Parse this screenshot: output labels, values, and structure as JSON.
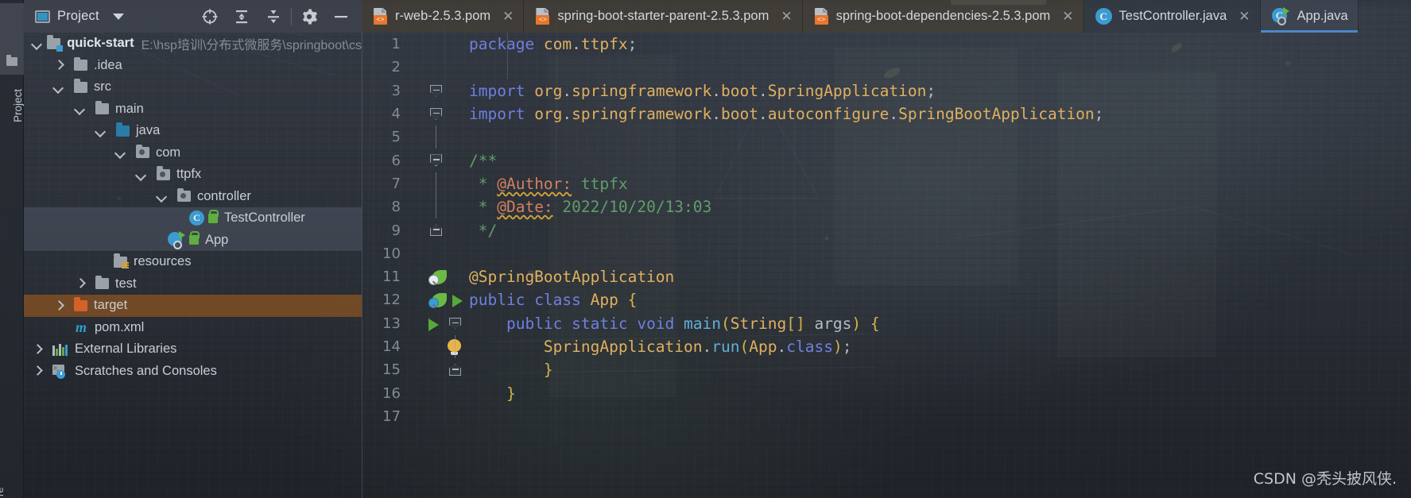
{
  "window": {
    "left_tool_bar": {
      "project_tab": "Project",
      "bottom_tab": "re"
    }
  },
  "project_panel": {
    "title": "Project",
    "icons": [
      {
        "name": "locate-icon",
        "glyph": "target"
      },
      {
        "name": "expand-all-icon",
        "glyph": "expand"
      },
      {
        "name": "collapse-all-icon",
        "glyph": "collapse"
      },
      {
        "name": "settings-gear-icon",
        "glyph": "gear"
      },
      {
        "name": "hide-icon",
        "glyph": "minus"
      }
    ]
  },
  "tabs": [
    {
      "label": "r-web-2.5.3.pom",
      "icon": "pom-file-icon",
      "kind": "pom",
      "active": false,
      "truncated": true
    },
    {
      "label": "spring-boot-starter-parent-2.5.3.pom",
      "icon": "pom-file-icon",
      "kind": "pom",
      "active": false
    },
    {
      "label": "spring-boot-dependencies-2.5.3.pom",
      "icon": "pom-file-icon",
      "kind": "pom",
      "active": false
    },
    {
      "label": "TestController.java",
      "icon": "java-class-icon",
      "kind": "java",
      "active": false
    },
    {
      "label": "App.java",
      "icon": "java-runnable-class-icon",
      "kind": "java",
      "active": true
    }
  ],
  "tab_close_glyph": "✕",
  "tree": [
    {
      "label": "quick-start",
      "secondary": "E:\\hsp培训\\分布式微服务\\springboot\\cs",
      "indent": 0,
      "arrow": "down",
      "icon": "module-folder-icon",
      "bold": true,
      "state": "none"
    },
    {
      "label": ".idea",
      "indent": 1,
      "arrow": "right",
      "icon": "folder-icon",
      "state": "none"
    },
    {
      "label": "src",
      "indent": 1,
      "arrow": "down",
      "icon": "folder-icon",
      "state": "none"
    },
    {
      "label": "main",
      "indent": 2,
      "arrow": "down",
      "icon": "folder-icon",
      "state": "none"
    },
    {
      "label": "java",
      "indent": 3,
      "arrow": "down",
      "icon": "source-root-folder-icon",
      "state": "none"
    },
    {
      "label": "com",
      "indent": 4,
      "arrow": "down",
      "icon": "package-folder-icon",
      "state": "none"
    },
    {
      "label": "ttpfx",
      "indent": 5,
      "arrow": "down",
      "icon": "package-folder-icon",
      "state": "none"
    },
    {
      "label": "controller",
      "indent": 6,
      "arrow": "down",
      "icon": "package-folder-icon",
      "state": "none"
    },
    {
      "label": "TestController",
      "indent": 7,
      "arrow": "none",
      "icon": "java-class-icon",
      "lock": true,
      "state": "highlight-blue"
    },
    {
      "label": "App",
      "indent": 6,
      "arrow": "none",
      "icon": "java-runnable-class-icon",
      "lock": true,
      "state": "highlight-gray"
    },
    {
      "label": "resources",
      "indent": 4,
      "arrow": "none",
      "icon": "resource-folder-icon",
      "state": "none"
    },
    {
      "label": "test",
      "indent": 3,
      "arrow": "right",
      "icon": "folder-icon",
      "state": "none"
    },
    {
      "label": "target",
      "indent": 2,
      "arrow": "right",
      "icon": "excluded-folder-icon",
      "state": "highlight-orange"
    },
    {
      "label": "pom.xml",
      "indent": 3,
      "arrow": "none",
      "icon": "maven-file-icon",
      "state": "none"
    },
    {
      "label": "External Libraries",
      "indent": 0,
      "arrow": "right",
      "icon": "libraries-icon",
      "state": "none"
    },
    {
      "label": "Scratches and Consoles",
      "indent": 0,
      "arrow": "right",
      "icon": "scratches-icon",
      "state": "none"
    }
  ],
  "editor": {
    "file": "App.java",
    "lines": [
      {
        "n": "1",
        "tokens": [
          {
            "t": "package ",
            "c": "kw"
          },
          {
            "t": "com",
            "c": "ident"
          },
          {
            "t": ".",
            "c": "plain"
          },
          {
            "t": "ttpfx",
            "c": "ident"
          },
          {
            "t": ";",
            "c": "plain"
          }
        ],
        "gutter": []
      },
      {
        "n": "2",
        "tokens": [],
        "gutter": []
      },
      {
        "n": "3",
        "tokens": [
          {
            "t": "import ",
            "c": "kw"
          },
          {
            "t": "org",
            "c": "ident"
          },
          {
            "t": ".",
            "c": "plain"
          },
          {
            "t": "springframework",
            "c": "ident"
          },
          {
            "t": ".",
            "c": "plain"
          },
          {
            "t": "boot",
            "c": "ident"
          },
          {
            "t": ".",
            "c": "plain"
          },
          {
            "t": "SpringApplication",
            "c": "ident"
          },
          {
            "t": ";",
            "c": "plain"
          }
        ],
        "gutter": [
          "fold-top"
        ]
      },
      {
        "n": "4",
        "tokens": [
          {
            "t": "import ",
            "c": "kw"
          },
          {
            "t": "org",
            "c": "ident"
          },
          {
            "t": ".",
            "c": "plain"
          },
          {
            "t": "springframework",
            "c": "ident"
          },
          {
            "t": ".",
            "c": "plain"
          },
          {
            "t": "boot",
            "c": "ident"
          },
          {
            "t": ".",
            "c": "plain"
          },
          {
            "t": "autoconfigure",
            "c": "ident"
          },
          {
            "t": ".",
            "c": "plain"
          },
          {
            "t": "SpringBootApplication",
            "c": "ident"
          },
          {
            "t": ";",
            "c": "plain"
          }
        ],
        "gutter": [
          "fold-bottom"
        ]
      },
      {
        "n": "5",
        "tokens": [],
        "gutter": []
      },
      {
        "n": "6",
        "tokens": [
          {
            "t": "/**",
            "c": "cmt"
          }
        ],
        "gutter": [
          "fold-top"
        ]
      },
      {
        "n": "7",
        "tokens": [
          {
            "t": " * ",
            "c": "cmt"
          },
          {
            "t": "@Author:",
            "c": "tag"
          },
          {
            "t": " ttpfx",
            "c": "cmt"
          }
        ],
        "gutter": []
      },
      {
        "n": "8",
        "tokens": [
          {
            "t": " * ",
            "c": "cmt"
          },
          {
            "t": "@Date:",
            "c": "tag"
          },
          {
            "t": " 2022/10/20/13:03",
            "c": "cmt"
          }
        ],
        "gutter": []
      },
      {
        "n": "9",
        "tokens": [
          {
            "t": " */",
            "c": "cmt"
          }
        ],
        "gutter": [
          "fold-bottom"
        ]
      },
      {
        "n": "10",
        "tokens": [],
        "gutter": []
      },
      {
        "n": "11",
        "tokens": [
          {
            "t": "@SpringBootApplication",
            "c": "annot"
          }
        ],
        "gutter": [
          "leaf-search"
        ]
      },
      {
        "n": "12",
        "tokens": [
          {
            "t": "public ",
            "c": "kw"
          },
          {
            "t": "class ",
            "c": "kw"
          },
          {
            "t": "App",
            "c": "ident"
          },
          {
            "t": " ",
            "c": "plain"
          },
          {
            "t": "{",
            "c": "punc"
          }
        ],
        "gutter": [
          "leaf-bean",
          "run"
        ]
      },
      {
        "n": "13",
        "tokens": [
          {
            "t": "    ",
            "c": "plain"
          },
          {
            "t": "public ",
            "c": "kw"
          },
          {
            "t": "static ",
            "c": "kw"
          },
          {
            "t": "void ",
            "c": "kw"
          },
          {
            "t": "main",
            "c": "meth"
          },
          {
            "t": "(",
            "c": "punc"
          },
          {
            "t": "String",
            "c": "ident"
          },
          {
            "t": "[] ",
            "c": "punc"
          },
          {
            "t": "args",
            "c": "plain"
          },
          {
            "t": ")",
            "c": "punc"
          },
          {
            "t": " ",
            "c": "plain"
          },
          {
            "t": "{",
            "c": "punc"
          }
        ],
        "gutter": [
          "run",
          "fold-top"
        ]
      },
      {
        "n": "14",
        "tokens": [
          {
            "t": "        ",
            "c": "plain"
          },
          {
            "t": "SpringApplication",
            "c": "ident"
          },
          {
            "t": ".",
            "c": "plain"
          },
          {
            "t": "run",
            "c": "meth"
          },
          {
            "t": "(",
            "c": "punc"
          },
          {
            "t": "App",
            "c": "ident"
          },
          {
            "t": ".",
            "c": "plain"
          },
          {
            "t": "class",
            "c": "kw"
          },
          {
            "t": ")",
            "c": "punc"
          },
          {
            "t": ";",
            "c": "plain"
          }
        ],
        "gutter": [
          "bulb"
        ]
      },
      {
        "n": "15",
        "tokens": [
          {
            "t": "        ",
            "c": "plain"
          },
          {
            "t": "}",
            "c": "punc"
          }
        ],
        "gutter": [
          "fold-bottom"
        ]
      },
      {
        "n": "16",
        "tokens": [
          {
            "t": "    ",
            "c": "plain"
          },
          {
            "t": "}",
            "c": "punc"
          }
        ],
        "gutter": []
      },
      {
        "n": "17",
        "tokens": [],
        "gutter": []
      }
    ]
  },
  "watermark": "CSDN @秃头披风侠.",
  "colors": {
    "accent_blue": "#3c9bd0",
    "run_green": "#56a839",
    "excluded_orange": "#d2622a",
    "keyword": "#6f7fe0",
    "identifier": "#e0b060",
    "comment": "#5f9e6a",
    "javadoc_tag": "#d48060",
    "method": "#61b0d8"
  }
}
